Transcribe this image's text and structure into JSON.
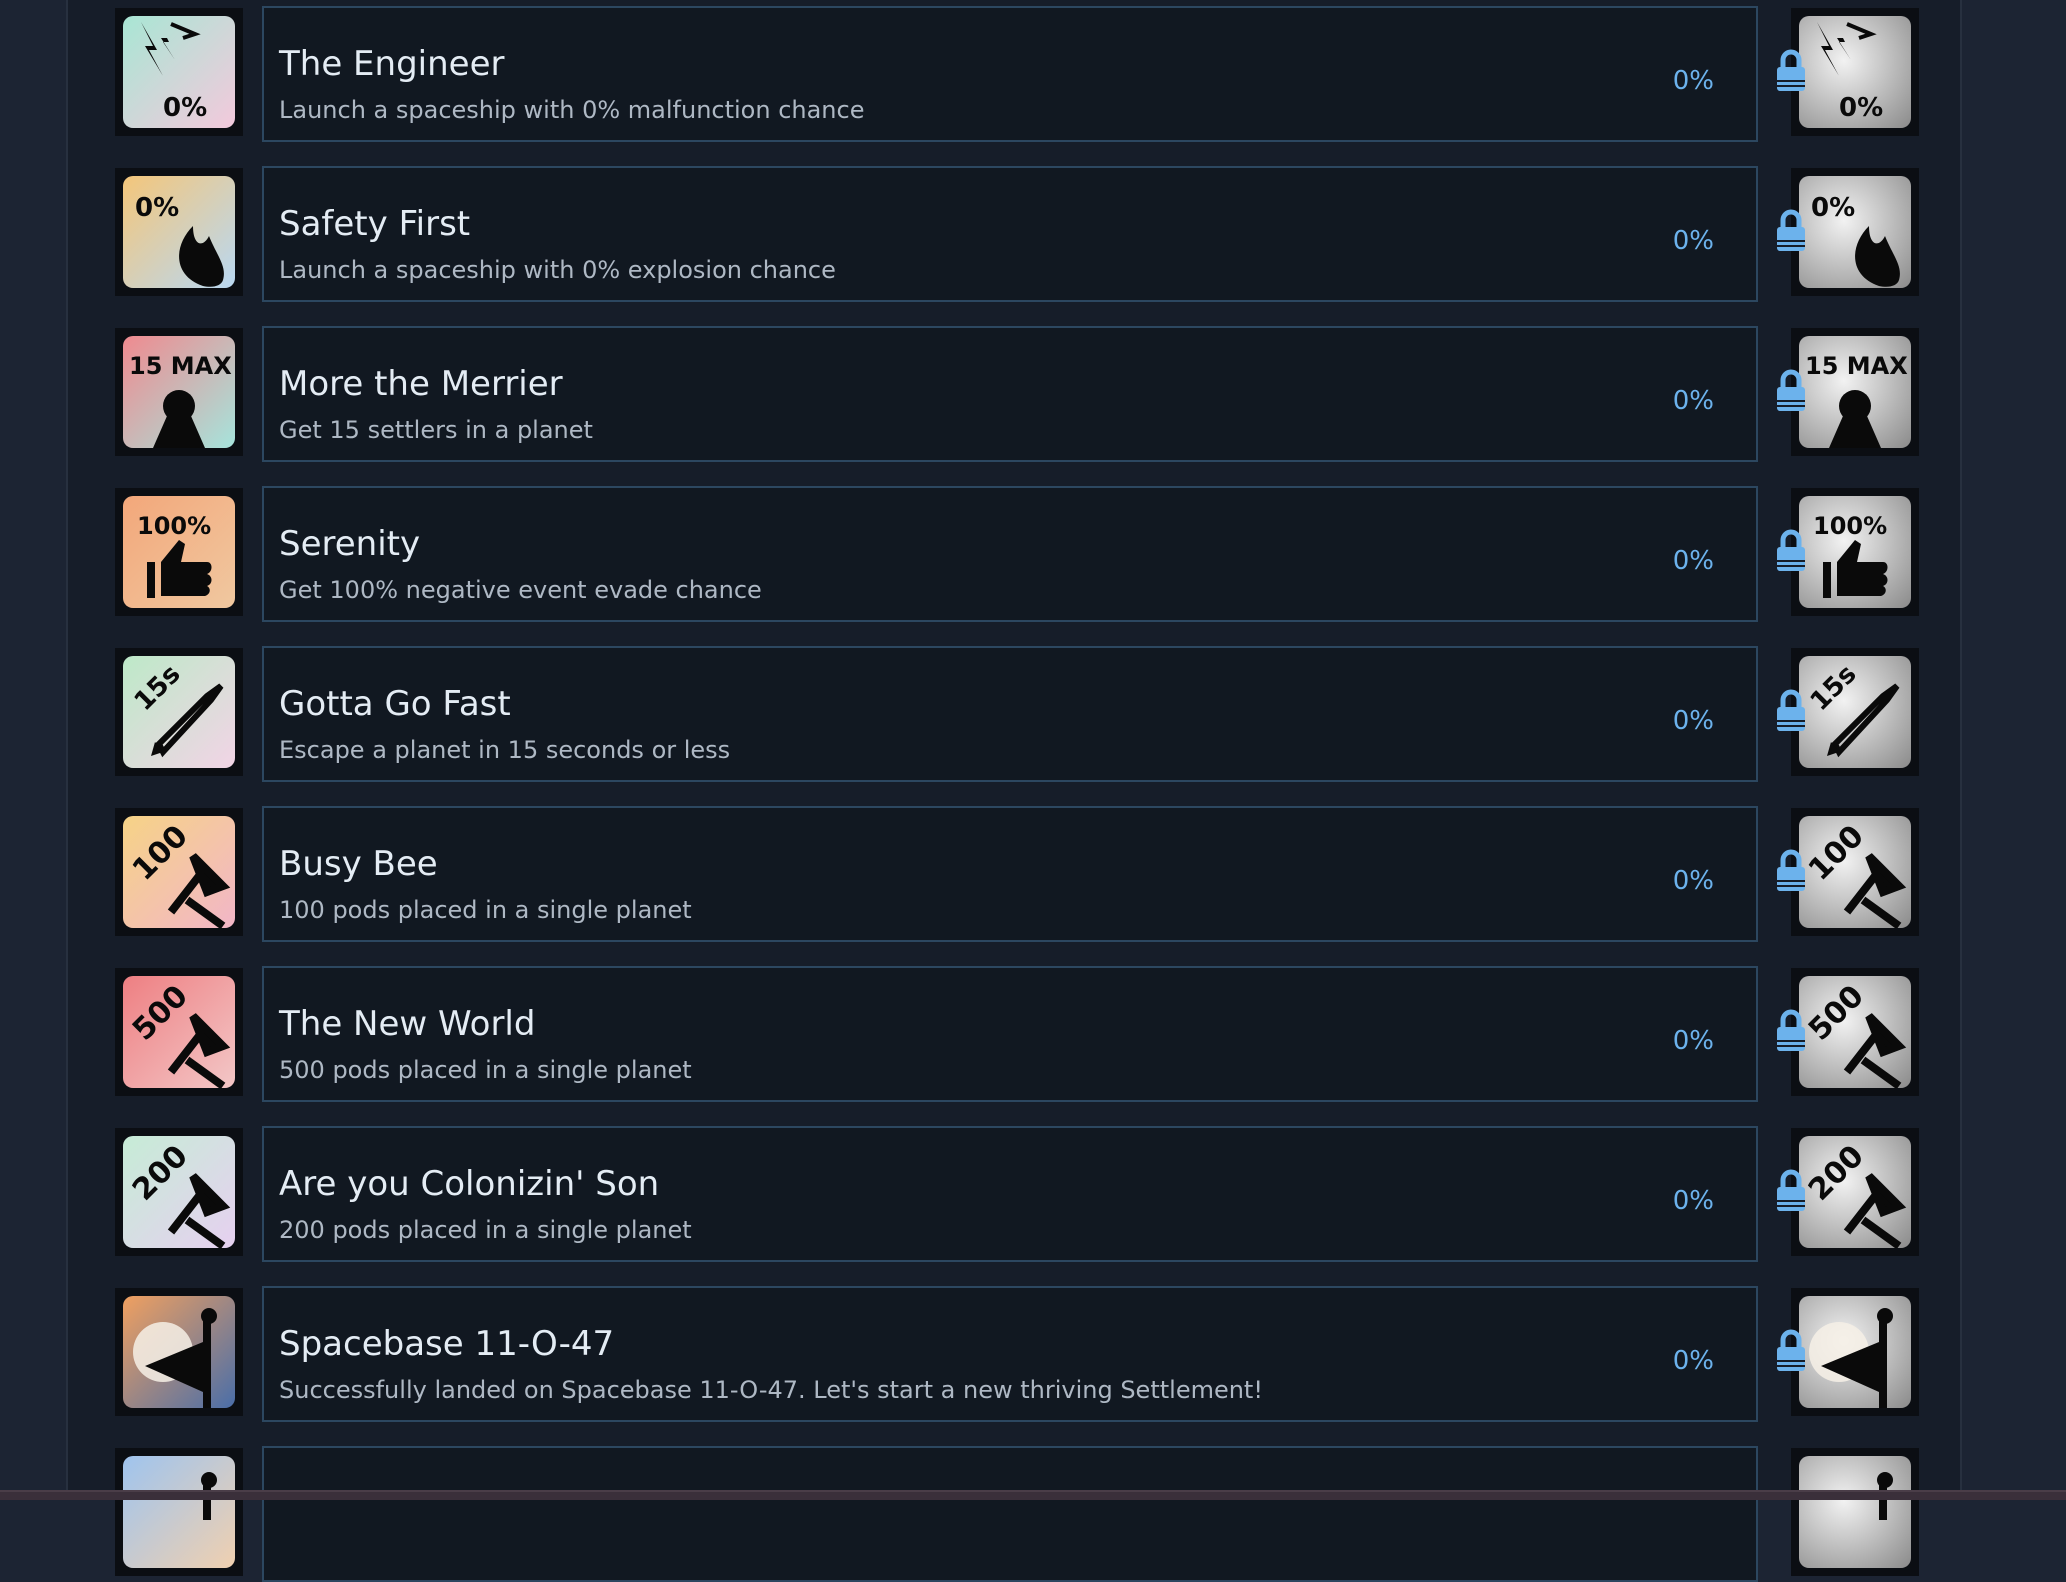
{
  "achievements": [
    {
      "title": "The Engineer",
      "description": "Launch a spaceship with 0% malfunction chance",
      "percent": "0%",
      "icon": "lightning-0pct-icon",
      "badge": "0%",
      "gradient": [
        "#a8e6d4",
        "#f3c9dc"
      ],
      "locked": true
    },
    {
      "title": "Safety First",
      "description": "Launch a spaceship with 0% explosion chance",
      "percent": "0%",
      "icon": "flame-0pct-icon",
      "badge": "0%",
      "gradient": [
        "#f4c67a",
        "#b9d8f2"
      ],
      "locked": true
    },
    {
      "title": "More the Merrier",
      "description": "Get 15 settlers in a planet",
      "percent": "0%",
      "icon": "settler-15max-icon",
      "badge": "15 MAX",
      "gradient": [
        "#ef8a8f",
        "#a6e4dc"
      ],
      "locked": true
    },
    {
      "title": "Serenity",
      "description": "Get 100% negative event evade chance",
      "percent": "0%",
      "icon": "thumbs-up-100pct-icon",
      "badge": "100%",
      "gradient": [
        "#f3a77a",
        "#f0c8a0"
      ],
      "locked": true
    },
    {
      "title": "Gotta Go Fast",
      "description": "Escape a planet in 15 seconds or less",
      "percent": "0%",
      "icon": "rocket-15s-icon",
      "badge": "15s",
      "gradient": [
        "#bde9c8",
        "#f2d4e6"
      ],
      "locked": true
    },
    {
      "title": "Busy Bee",
      "description": "100 pods placed in a single planet",
      "percent": "0%",
      "icon": "pods-100-icon",
      "badge": "100",
      "gradient": [
        "#f6d386",
        "#f2b6c8"
      ],
      "locked": true
    },
    {
      "title": "The New World",
      "description": "500 pods placed in a single planet",
      "percent": "0%",
      "icon": "pods-500-icon",
      "badge": "500",
      "gradient": [
        "#ee7f82",
        "#f3c7c7"
      ],
      "locked": true
    },
    {
      "title": "Are you Colonizin' Son",
      "description": "200 pods placed in a single planet",
      "percent": "0%",
      "icon": "pods-200-icon",
      "badge": "200",
      "gradient": [
        "#c6ecd6",
        "#e6d0f0"
      ],
      "locked": true
    },
    {
      "title": "Spacebase 11-O-47",
      "description": "Successfully landed on Spacebase 11-O-47. Let's start a new thriving Settlement!",
      "percent": "0%",
      "icon": "flag-planet-icon",
      "badge": "",
      "gradient": [
        "#f0a060",
        "#4a6ea8"
      ],
      "locked": true
    },
    {
      "title": "",
      "description": "",
      "percent": "",
      "icon": "partial-next-icon",
      "badge": "",
      "gradient": [
        "#9fc4ee",
        "#f0d0b0"
      ],
      "locked": true
    }
  ],
  "colors": {
    "percent": "#6cb2ec",
    "lock": "#6cb2ec",
    "card_border": "#2c4760"
  }
}
